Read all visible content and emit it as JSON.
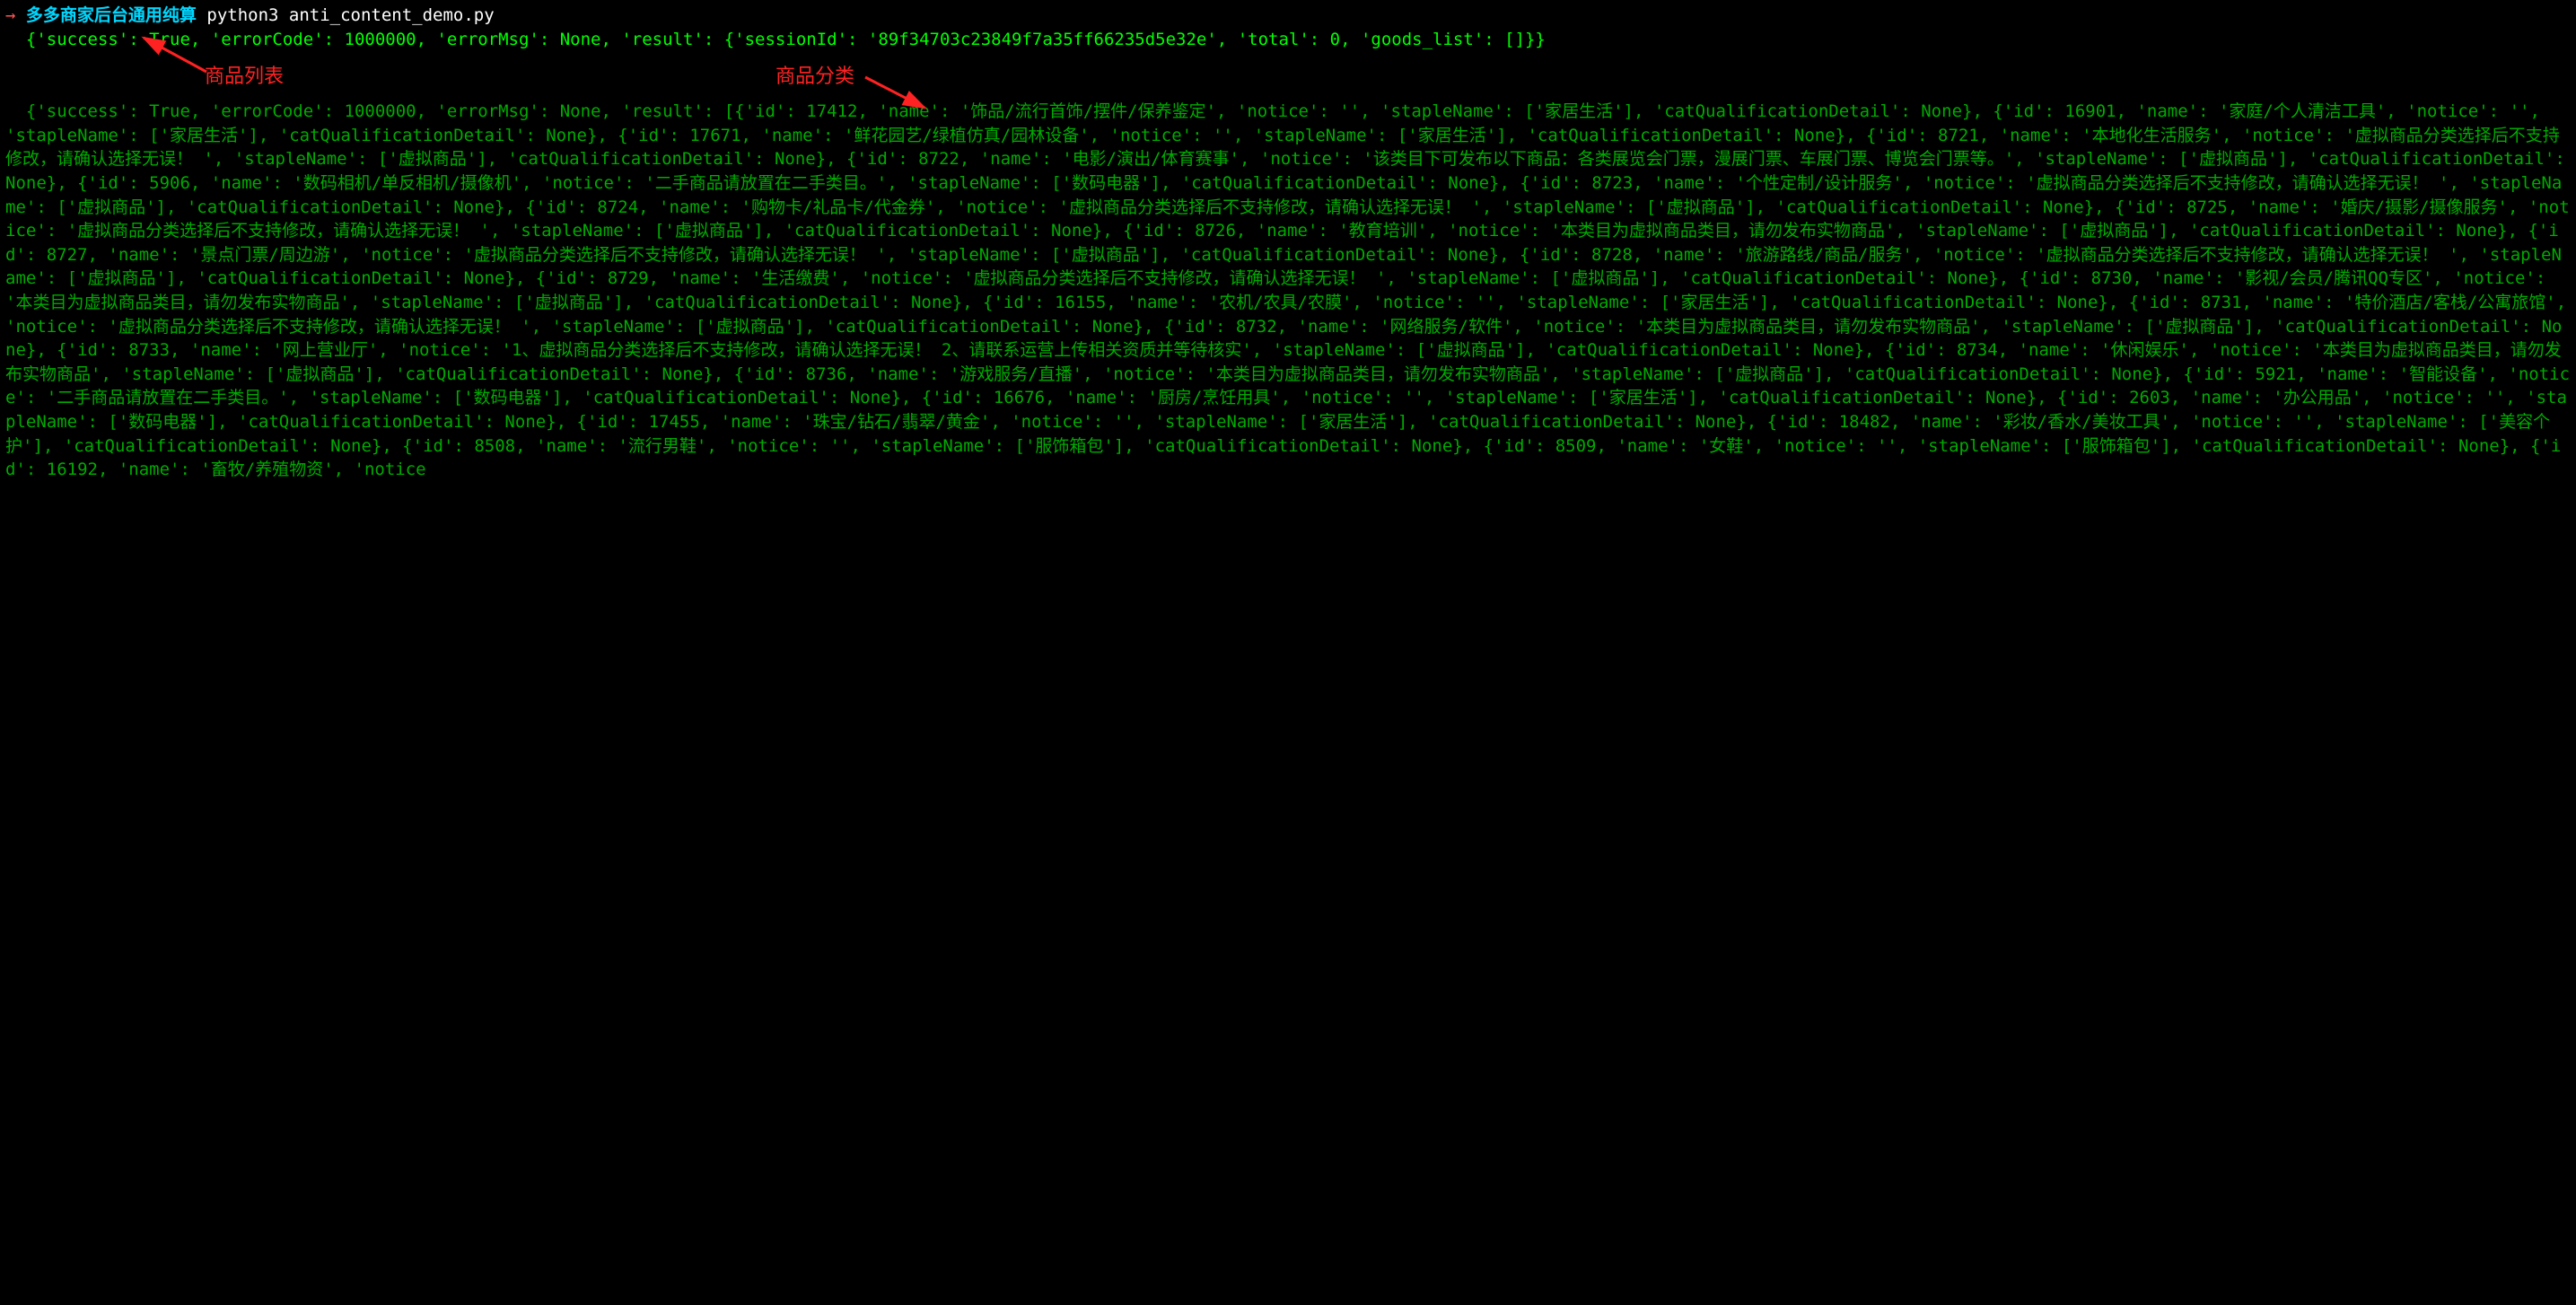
{
  "prompt": {
    "arrow": "→",
    "label": "多多商家后台通用纯算",
    "command": "python3 anti_content_demo.py"
  },
  "output_block_1": "  {'success': True, 'errorCode': 1000000, 'errorMsg': None, 'result': {'sessionId': '89f34703c23849f7a35ff66235d5e32e', 'total': 0, 'goods_list': []}}",
  "output_block_2": "  {'success': True, 'errorCode': 1000000, 'errorMsg': None, 'result': [{'id': 17412, 'name': '饰品/流行首饰/摆件/保养鉴定', 'notice': '', 'stapleName': ['家居生活'], 'catQualificationDetail': None}, {'id': 16901, 'name': '家庭/个人清洁工具', 'notice': '', 'stapleName': ['家居生活'], 'catQualificationDetail': None}, {'id': 17671, 'name': '鲜花园艺/绿植仿真/园林设备', 'notice': '', 'stapleName': ['家居生活'], 'catQualificationDetail': None}, {'id': 8721, 'name': '本地化生活服务', 'notice': '虚拟商品分类选择后不支持修改，请确认选择无误！ ', 'stapleName': ['虚拟商品'], 'catQualificationDetail': None}, {'id': 8722, 'name': '电影/演出/体育赛事', 'notice': '该类目下可发布以下商品：各类展览会门票，漫展门票、车展门票、博览会门票等。', 'stapleName': ['虚拟商品'], 'catQualificationDetail': None}, {'id': 5906, 'name': '数码相机/单反相机/摄像机', 'notice': '二手商品请放置在二手类目。', 'stapleName': ['数码电器'], 'catQualificationDetail': None}, {'id': 8723, 'name': '个性定制/设计服务', 'notice': '虚拟商品分类选择后不支持修改，请确认选择无误！ ', 'stapleName': ['虚拟商品'], 'catQualificationDetail': None}, {'id': 8724, 'name': '购物卡/礼品卡/代金券', 'notice': '虚拟商品分类选择后不支持修改，请确认选择无误！ ', 'stapleName': ['虚拟商品'], 'catQualificationDetail': None}, {'id': 8725, 'name': '婚庆/摄影/摄像服务', 'notice': '虚拟商品分类选择后不支持修改，请确认选择无误！ ', 'stapleName': ['虚拟商品'], 'catQualificationDetail': None}, {'id': 8726, 'name': '教育培训', 'notice': '本类目为虚拟商品类目，请勿发布实物商品', 'stapleName': ['虚拟商品'], 'catQualificationDetail': None}, {'id': 8727, 'name': '景点门票/周边游', 'notice': '虚拟商品分类选择后不支持修改，请确认选择无误！ ', 'stapleName': ['虚拟商品'], 'catQualificationDetail': None}, {'id': 8728, 'name': '旅游路线/商品/服务', 'notice': '虚拟商品分类选择后不支持修改，请确认选择无误！ ', 'stapleName': ['虚拟商品'], 'catQualificationDetail': None}, {'id': 8729, 'name': '生活缴费', 'notice': '虚拟商品分类选择后不支持修改，请确认选择无误！ ', 'stapleName': ['虚拟商品'], 'catQualificationDetail': None}, {'id': 8730, 'name': '影视/会员/腾讯QQ专区', 'notice': '本类目为虚拟商品类目，请勿发布实物商品', 'stapleName': ['虚拟商品'], 'catQualificationDetail': None}, {'id': 16155, 'name': '农机/农具/农膜', 'notice': '', 'stapleName': ['家居生活'], 'catQualificationDetail': None}, {'id': 8731, 'name': '特价酒店/客栈/公寓旅馆', 'notice': '虚拟商品分类选择后不支持修改，请确认选择无误！ ', 'stapleName': ['虚拟商品'], 'catQualificationDetail': None}, {'id': 8732, 'name': '网络服务/软件', 'notice': '本类目为虚拟商品类目，请勿发布实物商品', 'stapleName': ['虚拟商品'], 'catQualificationDetail': None}, {'id': 8733, 'name': '网上营业厅', 'notice': '1、虚拟商品分类选择后不支持修改，请确认选择无误！ 2、请联系运营上传相关资质并等待核实', 'stapleName': ['虚拟商品'], 'catQualificationDetail': None}, {'id': 8734, 'name': '休闲娱乐', 'notice': '本类目为虚拟商品类目，请勿发布实物商品', 'stapleName': ['虚拟商品'], 'catQualificationDetail': None}, {'id': 8736, 'name': '游戏服务/直播', 'notice': '本类目为虚拟商品类目，请勿发布实物商品', 'stapleName': ['虚拟商品'], 'catQualificationDetail': None}, {'id': 5921, 'name': '智能设备', 'notice': '二手商品请放置在二手类目。', 'stapleName': ['数码电器'], 'catQualificationDetail': None}, {'id': 16676, 'name': '厨房/烹饪用具', 'notice': '', 'stapleName': ['家居生活'], 'catQualificationDetail': None}, {'id': 2603, 'name': '办公用品', 'notice': '', 'stapleName': ['数码电器'], 'catQualificationDetail': None}, {'id': 17455, 'name': '珠宝/钻石/翡翠/黄金', 'notice': '', 'stapleName': ['家居生活'], 'catQualificationDetail': None}, {'id': 18482, 'name': '彩妆/香水/美妆工具', 'notice': '', 'stapleName': ['美容个护'], 'catQualificationDetail': None}, {'id': 8508, 'name': '流行男鞋', 'notice': '', 'stapleName': ['服饰箱包'], 'catQualificationDetail': None}, {'id': 8509, 'name': '女鞋', 'notice': '', 'stapleName': ['服饰箱包'], 'catQualificationDetail': None}, {'id': 16192, 'name': '畜牧/养殖物资', 'notice",
  "annotations": {
    "list": "商品列表",
    "category": "商品分类"
  }
}
